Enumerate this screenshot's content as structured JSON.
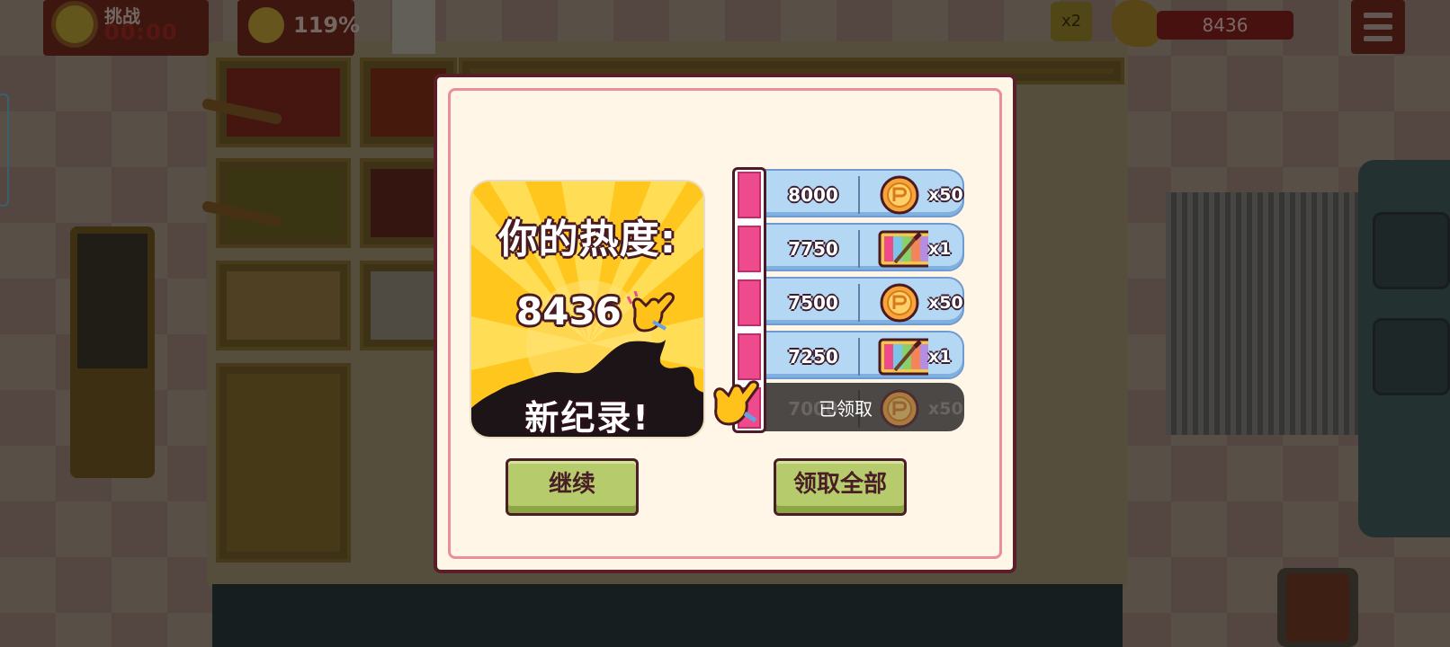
{
  "hud": {
    "challenge_label": "挑战",
    "timer": "00:00",
    "satisfaction": "119%",
    "multiplier": "x2",
    "score": "8436"
  },
  "dialog": {
    "heat_title": "你的热度:",
    "heat_value": "8436",
    "new_record": "新纪录!",
    "continue_button": "继续",
    "claim_all_button": "领取全部",
    "rewards": [
      {
        "threshold": "8000",
        "icon": "coin-icon",
        "qty": "x50",
        "claimed": false
      },
      {
        "threshold": "7750",
        "icon": "paint-ticket-icon",
        "qty": "x1",
        "claimed": false
      },
      {
        "threshold": "7500",
        "icon": "coin-icon",
        "qty": "x50",
        "claimed": false
      },
      {
        "threshold": "7250",
        "icon": "paint-ticket-icon",
        "qty": "x1",
        "claimed": false
      },
      {
        "threshold": "7000",
        "icon": "coin-icon",
        "qty": "x50",
        "claimed": true,
        "claimed_label": "已领取"
      }
    ]
  },
  "colors": {
    "modal_border": "#5a1e2a",
    "modal_inner_border": "#e88e9c",
    "progress_fill": "#ee4b8c",
    "reward_row": "#b4d8f4",
    "button_green": "#b6cc6c",
    "heat_card_yellow": "#ffc61e"
  }
}
